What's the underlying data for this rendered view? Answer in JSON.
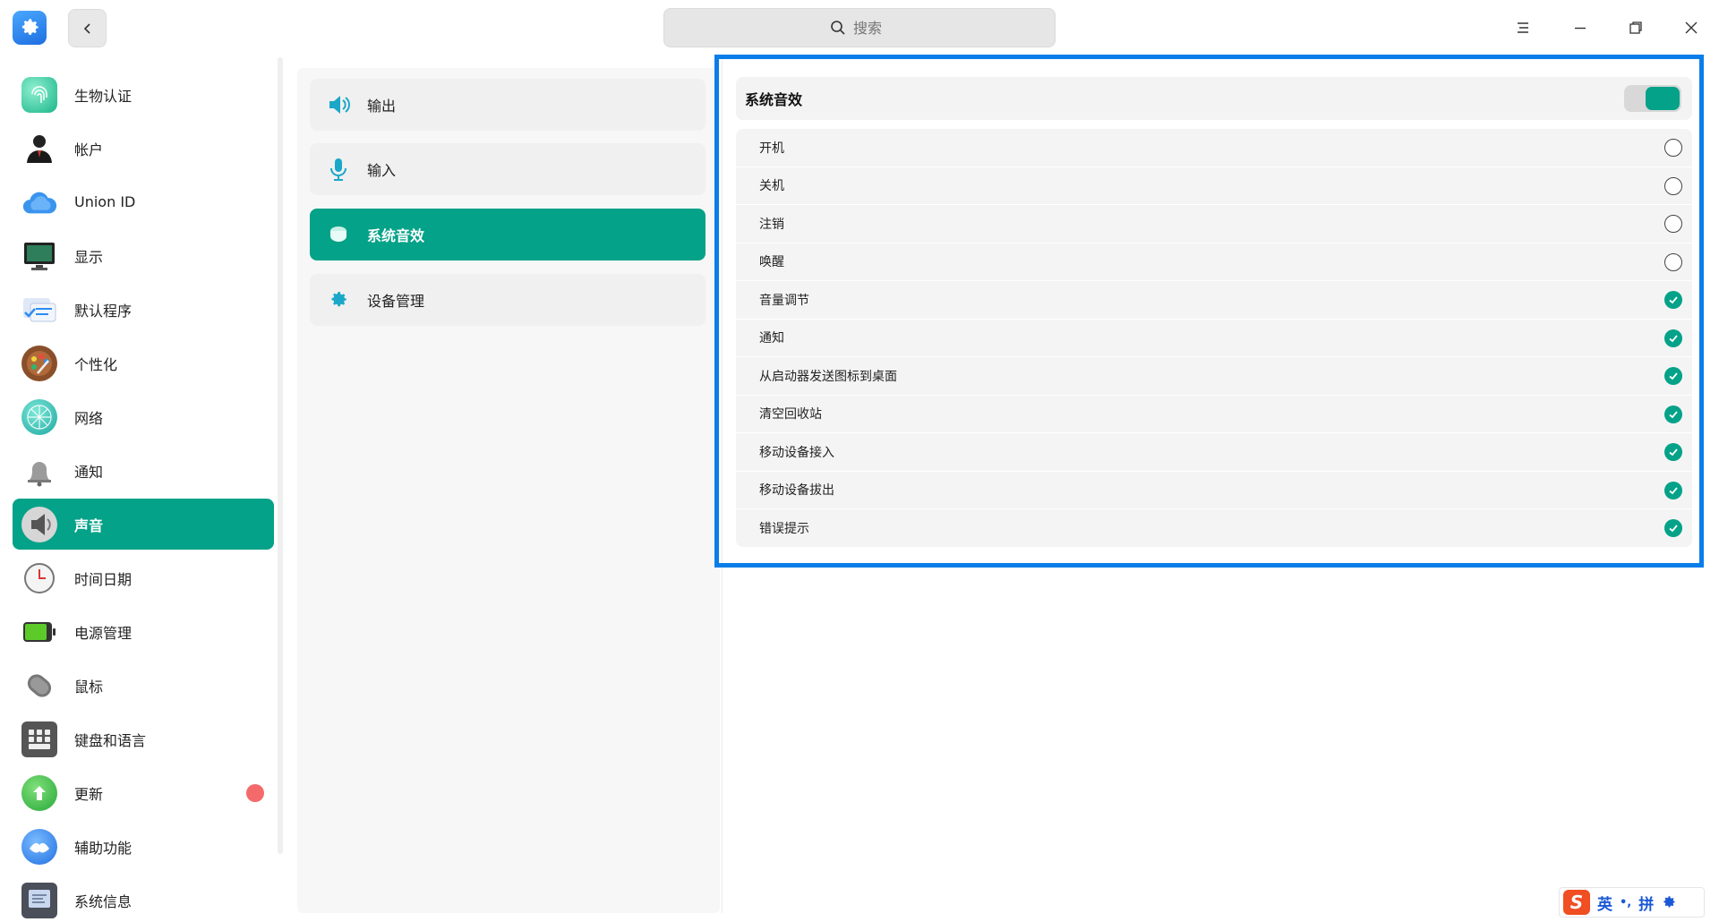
{
  "window": {
    "search_placeholder": "搜索"
  },
  "sidebar": {
    "items": [
      {
        "label": "生物认证",
        "icon": "fingerprint-icon"
      },
      {
        "label": "帐户",
        "icon": "account-icon"
      },
      {
        "label": "Union ID",
        "icon": "cloud-icon"
      },
      {
        "label": "显示",
        "icon": "display-icon"
      },
      {
        "label": "默认程序",
        "icon": "default-apps-icon"
      },
      {
        "label": "个性化",
        "icon": "palette-icon"
      },
      {
        "label": "网络",
        "icon": "network-icon"
      },
      {
        "label": "通知",
        "icon": "bell-icon"
      },
      {
        "label": "声音",
        "icon": "speaker-icon",
        "active": true
      },
      {
        "label": "时间日期",
        "icon": "clock-icon"
      },
      {
        "label": "电源管理",
        "icon": "battery-icon"
      },
      {
        "label": "鼠标",
        "icon": "mouse-icon"
      },
      {
        "label": "键盘和语言",
        "icon": "keyboard-icon"
      },
      {
        "label": "更新",
        "icon": "update-icon",
        "badge": true
      },
      {
        "label": "辅助功能",
        "icon": "accessibility-icon"
      },
      {
        "label": "系统信息",
        "icon": "system-info-icon"
      }
    ]
  },
  "sound_menu": {
    "items": [
      {
        "label": "输出",
        "icon": "speaker-output-icon"
      },
      {
        "label": "输入",
        "icon": "microphone-icon"
      },
      {
        "label": "系统音效",
        "icon": "sound-effects-icon",
        "active": true
      },
      {
        "label": "设备管理",
        "icon": "gear-icon"
      }
    ]
  },
  "effects": {
    "title": "系统音效",
    "enabled": true,
    "rows": [
      {
        "label": "开机",
        "checked": false
      },
      {
        "label": "关机",
        "checked": false
      },
      {
        "label": "注销",
        "checked": false
      },
      {
        "label": "唤醒",
        "checked": false
      },
      {
        "label": "音量调节",
        "checked": true
      },
      {
        "label": "通知",
        "checked": true
      },
      {
        "label": "从启动器发送图标到桌面",
        "checked": true
      },
      {
        "label": "清空回收站",
        "checked": true
      },
      {
        "label": "移动设备接入",
        "checked": true
      },
      {
        "label": "移动设备拔出",
        "checked": true
      },
      {
        "label": "错误提示",
        "checked": true
      }
    ]
  },
  "ime": {
    "logo": "S",
    "lang": "英",
    "punct": "•,",
    "mode": "拼"
  },
  "colors": {
    "accent": "#04a288",
    "highlight_border": "#0a7ee8",
    "badge": "#f46a6a"
  }
}
